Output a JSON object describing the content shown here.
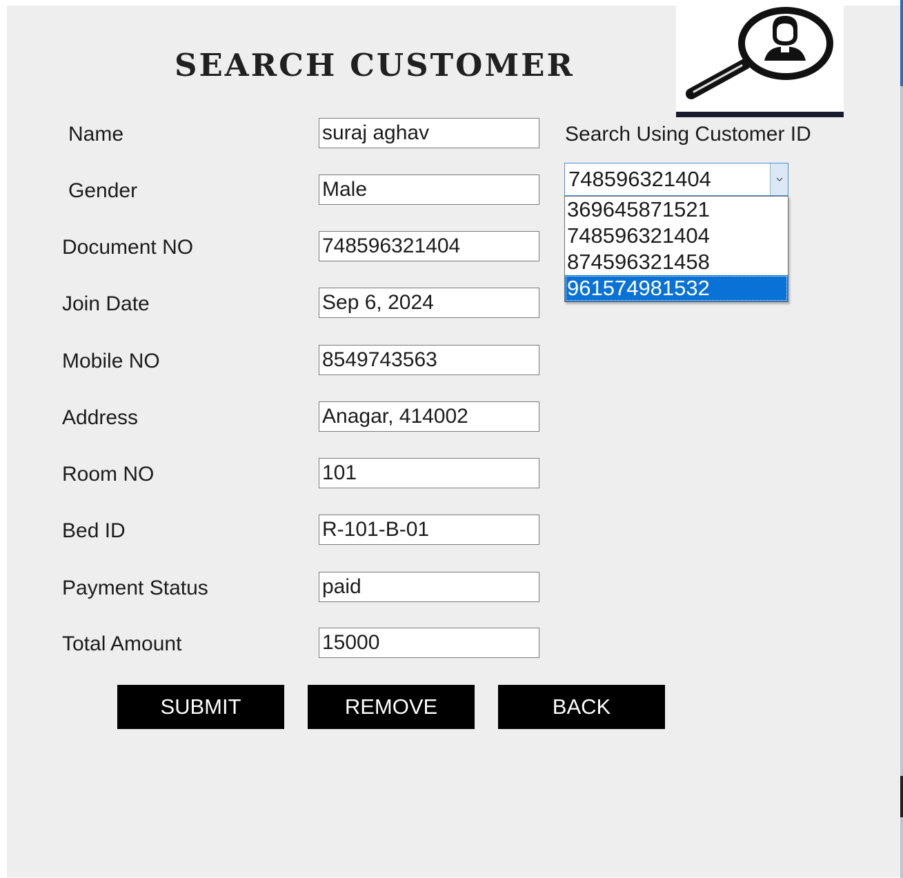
{
  "window": {
    "title": "SEARCH CUSTOMER",
    "logo_icon": "magnifier-customer-icon"
  },
  "form": {
    "fields": [
      {
        "label": "Name",
        "value": "suraj aghav"
      },
      {
        "label": "Gender",
        "value": "Male"
      },
      {
        "label": "Document NO",
        "value": "748596321404"
      },
      {
        "label": "Join Date",
        "value": "Sep 6, 2024"
      },
      {
        "label": "Mobile NO",
        "value": "8549743563"
      },
      {
        "label": "Address",
        "value": "Anagar, 414002"
      },
      {
        "label": "Room NO",
        "value": "101"
      },
      {
        "label": "Bed ID",
        "value": "R-101-B-01"
      },
      {
        "label": "Payment Status",
        "value": "paid"
      },
      {
        "label": "Total Amount",
        "value": "15000"
      }
    ]
  },
  "search": {
    "label": "Search Using Customer ID",
    "selected": "748596321404",
    "options": [
      "369645871521",
      "748596321404",
      "874596321458",
      "961574981532"
    ],
    "highlighted_option": "961574981532"
  },
  "buttons": {
    "submit": "SUBMIT",
    "remove": "REMOVE",
    "back": "BACK"
  },
  "colors": {
    "background": "#eeeeee",
    "button": "#000000",
    "highlight": "#0a72d6"
  }
}
